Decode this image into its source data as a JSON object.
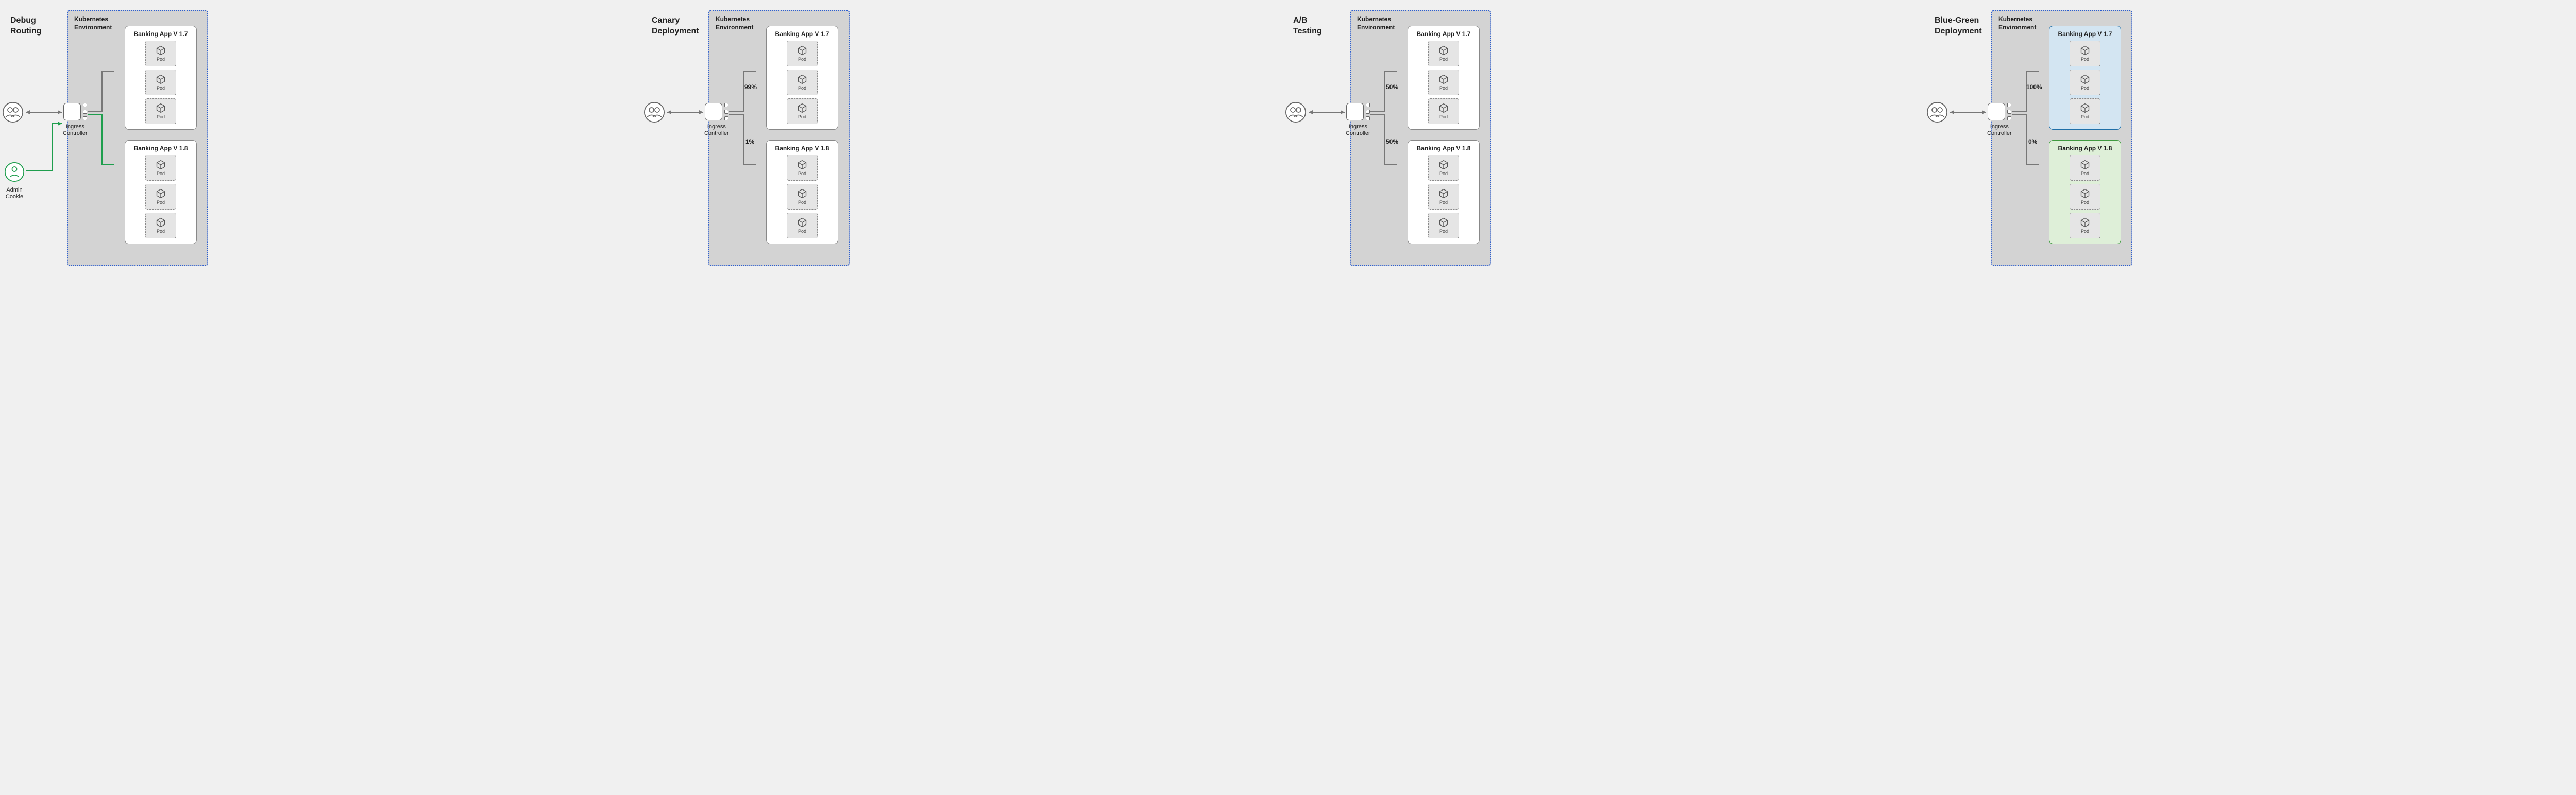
{
  "scenarios": [
    {
      "title": "Debug\nRouting",
      "envLabel": "Kubernetes\nEnvironment",
      "ingressLabel": "Ingress\nController",
      "adminLabel": "Admin\nCookie",
      "app1": "Banking App V 1.7",
      "app2": "Banking App V 1.8",
      "podLabel": "Pod",
      "pctTop": "",
      "pctBottom": ""
    },
    {
      "title": "Canary\nDeployment",
      "envLabel": "Kubernetes\nEnvironment",
      "ingressLabel": "Ingress\nController",
      "app1": "Banking App V 1.7",
      "app2": "Banking App V 1.8",
      "podLabel": "Pod",
      "pctTop": "99%",
      "pctBottom": "1%"
    },
    {
      "title": "A/B\nTesting",
      "envLabel": "Kubernetes\nEnvironment",
      "ingressLabel": "Ingress\nController",
      "app1": "Banking App V 1.7",
      "app2": "Banking App V 1.8",
      "podLabel": "Pod",
      "pctTop": "50%",
      "pctBottom": "50%"
    },
    {
      "title": "Blue-Green\nDeployment",
      "envLabel": "Kubernetes\nEnvironment",
      "ingressLabel": "Ingress\nController",
      "app1": "Banking App V 1.7",
      "app2": "Banking App V 1.8",
      "podLabel": "Pod",
      "pctTop": "100%",
      "pctBottom": "0%"
    }
  ]
}
